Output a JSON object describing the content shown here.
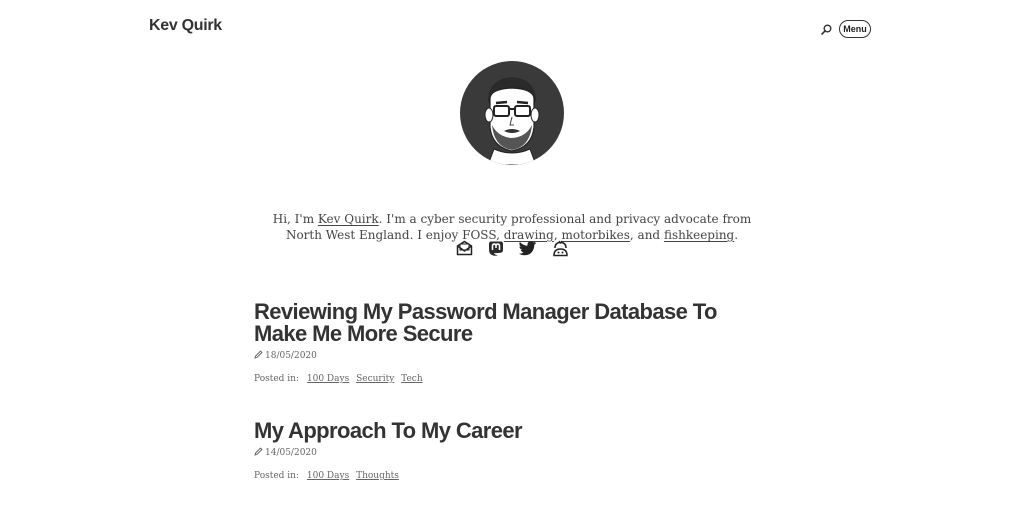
{
  "header": {
    "site_title": "Kev Quirk",
    "menu_label": "Menu",
    "search_icon": "search-icon"
  },
  "intro": {
    "text_1": "Hi, I'm ",
    "name_link": "Kev Quirk",
    "text_2": ". I'm a cyber security professional and privacy advocate from North West England. I enjoy FOSS, ",
    "drawing_link": "drawing",
    "text_3": ", ",
    "motorbikes_link": "motorbikes",
    "text_4": ", and ",
    "fishkeeping_link": "fishkeeping",
    "text_5": "."
  },
  "social": [
    "email-icon",
    "mastodon-icon",
    "twitter-icon",
    "xmpp-icon"
  ],
  "posts": [
    {
      "title": "Reviewing My Password Manager Database To Make Me More Secure",
      "date": "18/05/2020",
      "posted_in_label": "Posted in:",
      "tags": [
        "100 Days",
        "Security",
        "Tech"
      ]
    },
    {
      "title": "My Approach To My Career",
      "date": "14/05/2020",
      "posted_in_label": "Posted in:",
      "tags": [
        "100 Days",
        "Thoughts"
      ]
    }
  ]
}
